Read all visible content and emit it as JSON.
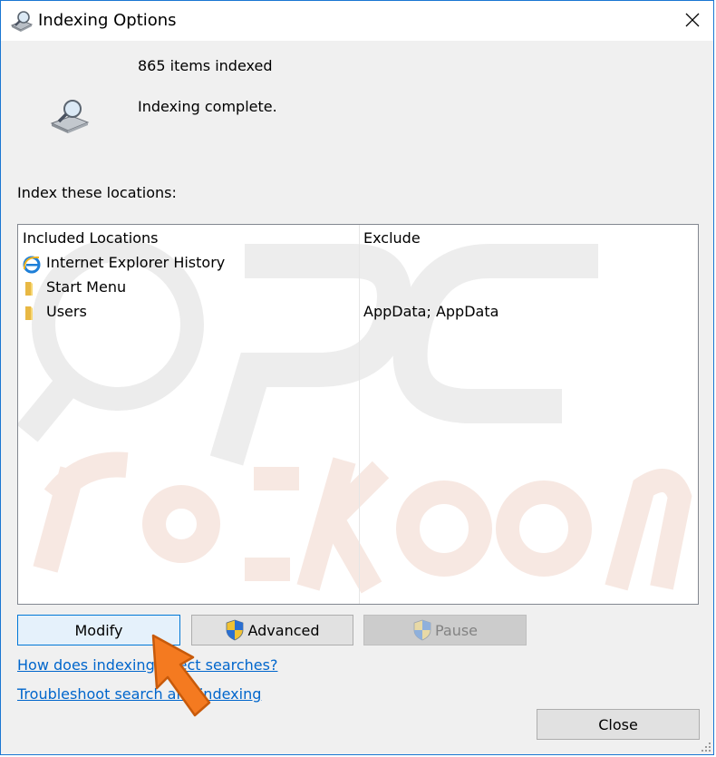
{
  "window": {
    "title": "Indexing Options"
  },
  "status": {
    "items_indexed": "865 items indexed",
    "message": "Indexing complete."
  },
  "locations": {
    "label": "Index these locations:",
    "columns": {
      "included": "Included Locations",
      "exclude": "Exclude"
    },
    "rows": [
      {
        "name": "Internet Explorer History",
        "exclude": "",
        "icon": "internet-explorer-icon"
      },
      {
        "name": "Start Menu",
        "exclude": "",
        "icon": "folder-icon"
      },
      {
        "name": "Users",
        "exclude": "AppData; AppData",
        "icon": "folder-icon"
      }
    ]
  },
  "buttons": {
    "modify": "Modify",
    "advanced": "Advanced",
    "pause": "Pause",
    "close": "Close"
  },
  "links": {
    "how_indexing": "How does indexing affect searches?",
    "troubleshoot": "Troubleshoot search and indexing"
  },
  "colors": {
    "accent": "#0078d7",
    "link": "#0066cc",
    "watermark": "#e8e8e8"
  }
}
